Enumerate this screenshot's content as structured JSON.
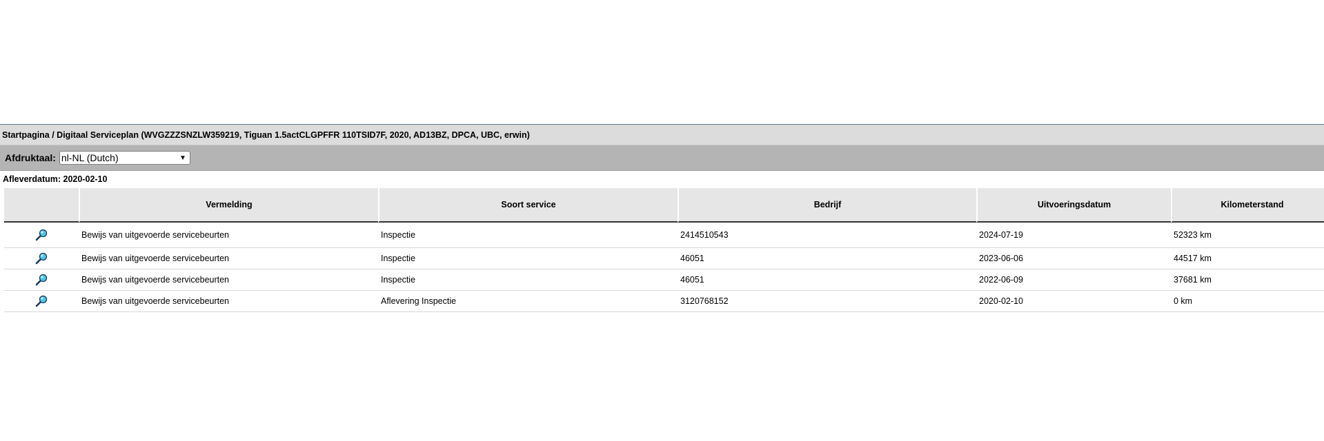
{
  "breadcrumb": "Startpagina / Digitaal Serviceplan (WVGZZZSNZLW359219, Tiguan 1.5actCLGPFFR 110TSID7F, 2020, AD13BZ, DPCA, UBC, erwin)",
  "language": {
    "label": "Afdruktaal:",
    "selected": "nl-NL (Dutch)"
  },
  "delivery_date": "Afleverdatum: 2020-02-10",
  "table": {
    "headers": [
      "",
      "Vermelding",
      "Soort service",
      "Bedrijf",
      "Uitvoeringsdatum",
      "Kilometerstand"
    ],
    "rows": [
      {
        "icon": "magnifier-icon",
        "vermelding": "Bewijs van uitgevoerde servicebeurten",
        "soort": "Inspectie",
        "bedrijf": "2414510543",
        "datum": "2024-07-19",
        "km": "52323 km"
      },
      {
        "icon": "magnifier-icon",
        "vermelding": "Bewijs van uitgevoerde servicebeurten",
        "soort": "Inspectie",
        "bedrijf": "46051",
        "datum": "2023-06-06",
        "km": "44517 km"
      },
      {
        "icon": "magnifier-icon",
        "vermelding": "Bewijs van uitgevoerde servicebeurten",
        "soort": "Inspectie",
        "bedrijf": "46051",
        "datum": "2022-06-09",
        "km": "37681 km"
      },
      {
        "icon": "magnifier-icon",
        "vermelding": "Bewijs van uitgevoerde servicebeurten",
        "soort": "Aflevering Inspectie",
        "bedrijf": "3120768152",
        "datum": "2020-02-10",
        "km": "0 km"
      }
    ]
  },
  "colors": {
    "breadcrumb_bg": "#dcdcdc",
    "language_bar_bg": "#b4b4b4",
    "header_bg": "#e6e6e6",
    "icon_lens": "#4fc3e8",
    "icon_handle": "#1a3a5a"
  }
}
